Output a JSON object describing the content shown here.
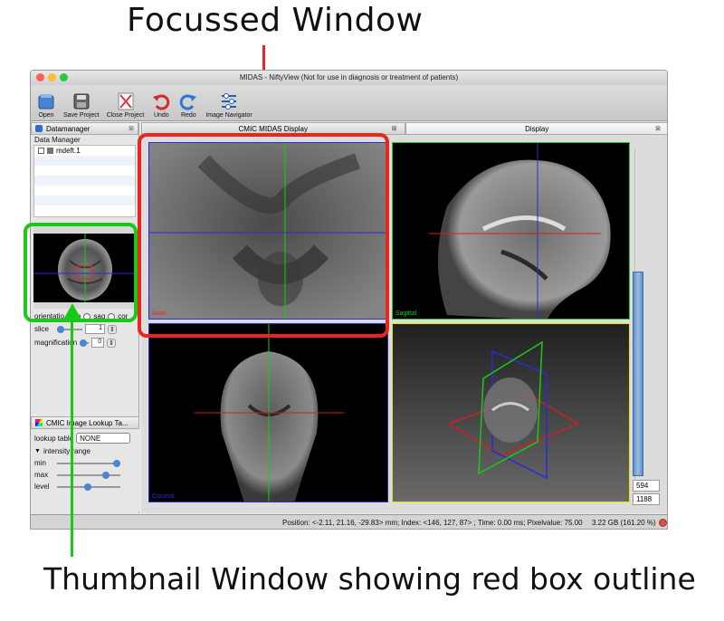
{
  "captions": {
    "top": "Focussed Window",
    "bottom": "Thumbnail Window showing red box outline"
  },
  "window": {
    "title": "MIDAS - NiftyView (Not for use in diagnosis or treatment of patients)"
  },
  "toolbar": {
    "open": "Open",
    "save_project": "Save Project",
    "close_project": "Close Project",
    "undo": "Undo",
    "redo": "Redo",
    "image_navigator": "Image Navigator"
  },
  "datamanager": {
    "tab": "Datamanager",
    "label": "Data Manager",
    "item": "mdeft.1"
  },
  "controls": {
    "orientation_label": "orientatio",
    "opt1": "a",
    "opt2": "sag",
    "opt3": "cor",
    "slice_label": "slice",
    "slice_value": "1",
    "magnification_label": "magnification",
    "magnification_value": "0"
  },
  "lut": {
    "title": "CMIC Image Lookup Ta...",
    "table_label": "lookup table",
    "table_value": "NONE",
    "intensity_label": "intensity range",
    "min_label": "min",
    "max_label": "max",
    "level_label": "level"
  },
  "tabs": {
    "main1": "CMIC MIDAS Display",
    "main2": "Display"
  },
  "panes": {
    "axial": "Axial",
    "sagittal": "Sagittal",
    "coronal": "Coronal"
  },
  "scale": {
    "value1": "594",
    "value2": "1188"
  },
  "status": {
    "text": "Position: <-2.11, 21.16, -29.83> mm; Index: <146, 127, 87> ; Time: 0.00 ms; Pixelvalue: 75.00",
    "memory": "3.22 GB (161.20 %)"
  },
  "colors": {
    "focus_red": "#e8261f",
    "thumb_green": "#18c918",
    "crosshair_green": "#1fc61f",
    "crosshair_blue": "#2a2ad8",
    "crosshair_red": "#d02020"
  }
}
